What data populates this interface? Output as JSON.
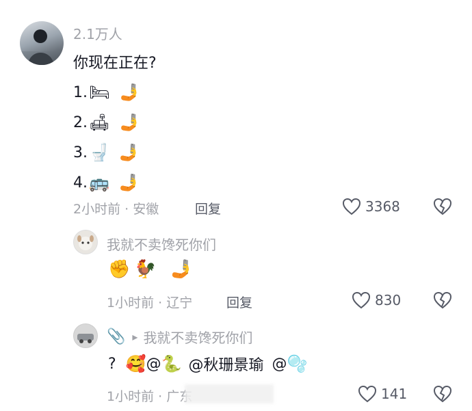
{
  "comment": {
    "author": "2.1万人",
    "text": "你现在正在?",
    "options": [
      {
        "num": "1.",
        "emoji": "🛏",
        "hand": "🤳"
      },
      {
        "num": "2.",
        "emoji": "🛋",
        "hand": "🤳"
      },
      {
        "num": "3.",
        "emoji": "🚽",
        "hand": "🤳"
      },
      {
        "num": "4.",
        "emoji": "🚌",
        "hand": "🤳"
      }
    ],
    "time": "2小时前 · 安徽",
    "reply_label": "回复",
    "likes": "3368"
  },
  "reply1": {
    "author": "我就不卖馋死你们",
    "emojis": "✊🐓 🤳",
    "time": "1小时前 · 辽宁",
    "reply_label": "回复",
    "likes": "830"
  },
  "reply2": {
    "author_emoji": "📎",
    "arrow": "▸",
    "reply_to": "我就不卖馋死你们",
    "text_q": "?",
    "mention1_emoji": "🥰",
    "mention1_at": "@",
    "mention2_emoji": "🐍",
    "mention3": "@秋珊景瑜",
    "mention4_at": "@",
    "mention4_emoji": "🫧",
    "time": "1小时前 · 广东",
    "likes": "141"
  },
  "colors": {
    "text": "#161823",
    "muted": "#a0a2a8",
    "action": "#565a66"
  }
}
